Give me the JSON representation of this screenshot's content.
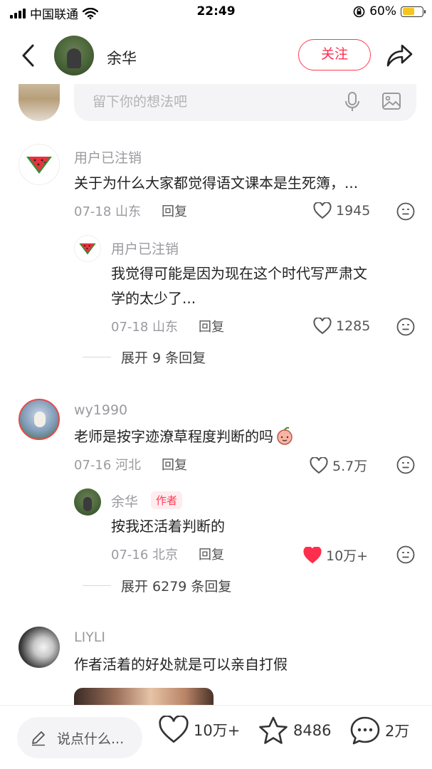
{
  "status_bar": {
    "carrier": "中国联通",
    "time": "22:49",
    "battery_percent": "60%",
    "battery_level": 0.6
  },
  "nav": {
    "title": "余华",
    "follow_label": "关注"
  },
  "input": {
    "placeholder": "留下你的想法吧"
  },
  "comments": [
    {
      "user": "用户已注销",
      "text": "关于为什么大家都觉得语文课本是生死簿，...",
      "date": "07-18",
      "location": "山东",
      "reply_label": "回复",
      "likes": "1945",
      "sub_reply": {
        "user": "用户已注销",
        "text_line1": "我觉得可能是因为现在这个时代写严肃文",
        "text_line2": "学的太少了...",
        "date": "07-18",
        "location": "山东",
        "reply_label": "回复",
        "likes": "1285"
      },
      "expand_label": "展开 9 条回复"
    },
    {
      "user": "wy1990",
      "text": "老师是按字迹潦草程度判断的吗",
      "date": "07-16",
      "location": "河北",
      "reply_label": "回复",
      "likes": "5.7万",
      "sub_reply": {
        "user": "余华",
        "author_tag": "作者",
        "text": "按我还活着判断的",
        "date": "07-16",
        "location": "北京",
        "reply_label": "回复",
        "likes": "10万+",
        "liked": true
      },
      "expand_label": "展开 6279 条回复"
    },
    {
      "user": "LIYLI",
      "text": "作者活着的好处就是可以亲自打假"
    }
  ],
  "bottom_bar": {
    "say_placeholder": "说点什么...",
    "likes": "10万+",
    "favorites": "8486",
    "comments": "2万"
  },
  "colors": {
    "accent": "#ff2e4d",
    "muted_text": "#9a9aa0",
    "input_bg": "#f4f4f6"
  }
}
